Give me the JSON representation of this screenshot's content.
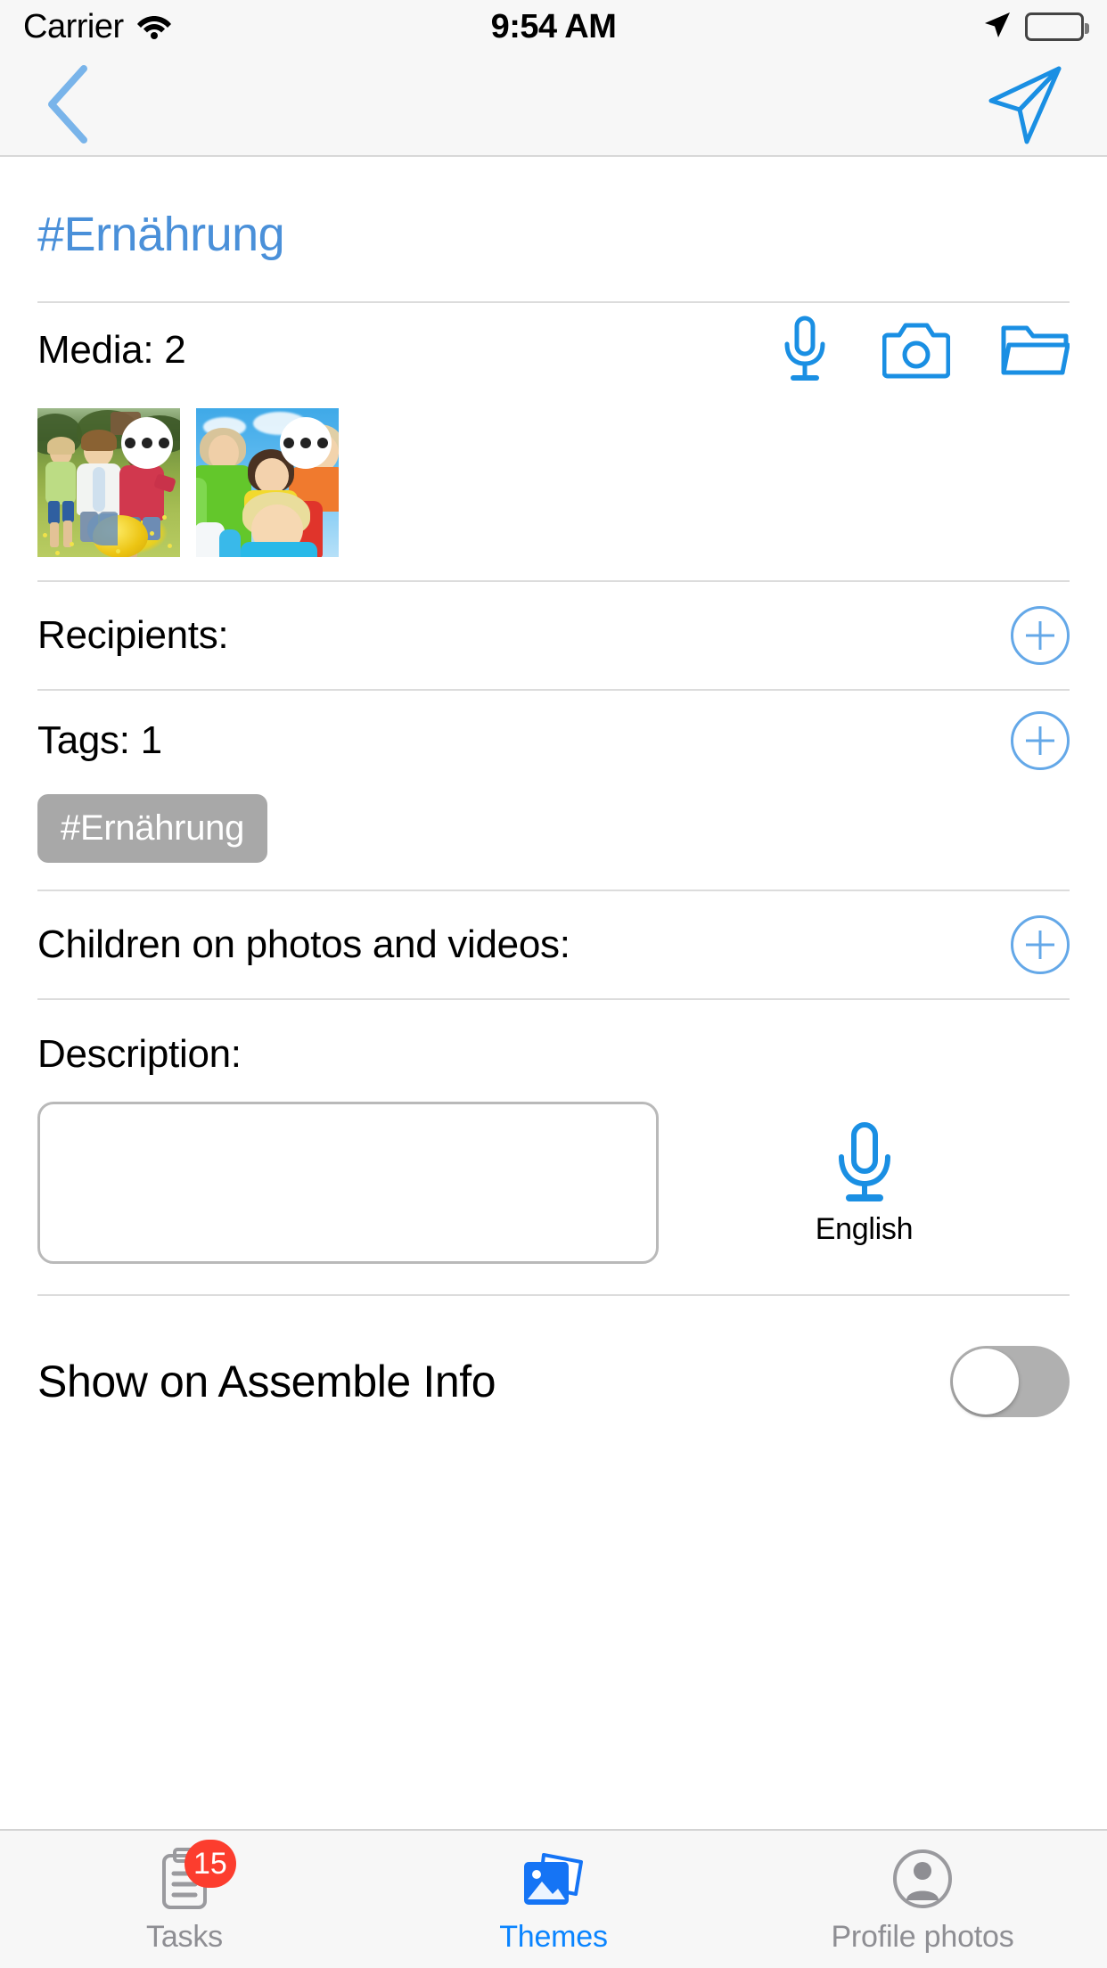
{
  "status_bar": {
    "carrier": "Carrier",
    "time": "9:54 AM",
    "wifi_icon": "wifi-icon",
    "location_icon": "location-arrow-icon",
    "battery_icon": "battery-full-icon"
  },
  "nav_bar": {
    "back_icon": "chevron-left-icon",
    "send_icon": "paper-plane-send-icon"
  },
  "theme": {
    "title": "#Ernährung"
  },
  "media": {
    "label": "Media: 2",
    "count": 2,
    "actions": [
      {
        "name": "microphone-icon",
        "label": "Record audio"
      },
      {
        "name": "camera-icon",
        "label": "Take photo"
      },
      {
        "name": "folder-icon",
        "label": "Open folder"
      }
    ],
    "thumbnails": [
      {
        "alt": "Children running in a flower meadow",
        "overlay": "more-options-icon"
      },
      {
        "alt": "Group of smiling children under a blue sky",
        "overlay": "more-options-icon"
      }
    ]
  },
  "recipients": {
    "label": "Recipients:",
    "add_icon": "plus-circle-icon"
  },
  "tags": {
    "label": "Tags: 1",
    "count": 1,
    "add_icon": "plus-circle-icon",
    "items": [
      "#Ernährung"
    ]
  },
  "children": {
    "label": "Children on photos and videos:",
    "add_icon": "plus-circle-icon"
  },
  "description": {
    "label": "Description:",
    "value": "",
    "placeholder": "",
    "mic_icon": "microphone-icon",
    "language": "English"
  },
  "assemble_info": {
    "label": "Show on Assemble Info",
    "enabled": false
  },
  "tab_bar": {
    "items": [
      {
        "label": "Tasks",
        "icon": "clipboard-icon",
        "badge": "15",
        "active": false
      },
      {
        "label": "Themes",
        "icon": "photos-icon",
        "badge": "",
        "active": true
      },
      {
        "label": "Profile photos",
        "icon": "person-circle-icon",
        "badge": "",
        "active": false
      }
    ]
  },
  "colors": {
    "accent_blue": "#0a84ff",
    "title_blue": "#4a90d9",
    "outline_blue": "#64a8e8",
    "chip_gray": "#a8a8a8",
    "badge_red": "#fc3d2e",
    "inactive_gray": "#8e8e93"
  }
}
